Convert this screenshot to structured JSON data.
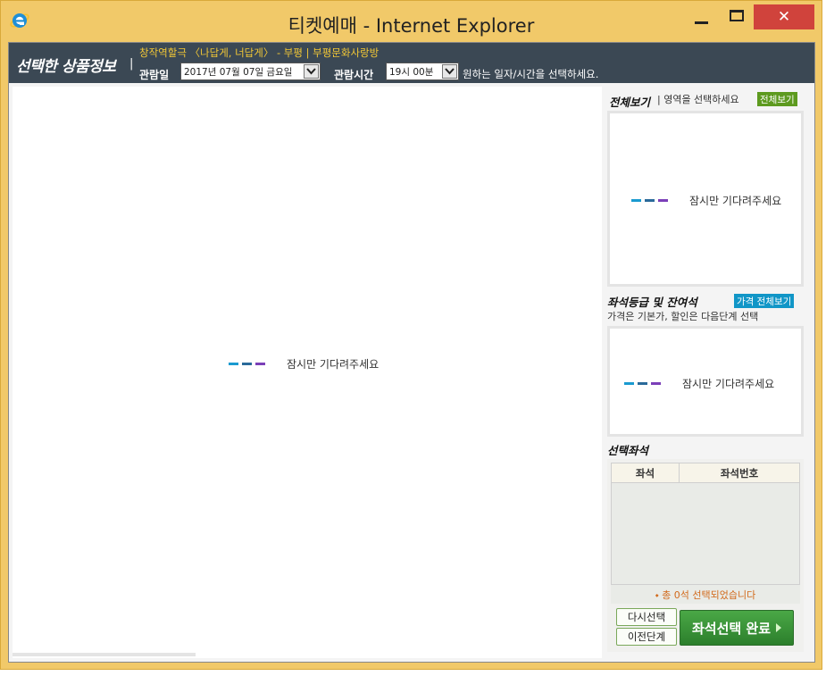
{
  "window": {
    "title": "티켓예매 - Internet Explorer",
    "close_glyph": "✕"
  },
  "header": {
    "title": "선택한 상품정보",
    "separator": "|",
    "show_title": "창작역할극 〈나답게, 너답게〉 - 부평 | 부평문화사랑방",
    "date_label": "관람일",
    "date_value": "2017년 07월 07일 금요일",
    "time_label": "관람시간",
    "time_value": "19시 00분",
    "guide": "원하는 일자/시간을 선택하세요."
  },
  "seatmap": {
    "loading_text": "잠시만 기다려주세요"
  },
  "overview": {
    "title": "전체보기",
    "subtitle": "| 영역을 선택하세요",
    "button": "전체보기",
    "loading_text": "잠시만 기다려주세요"
  },
  "grades": {
    "title": "좌석등급 및 잔여석",
    "button": "가격 전체보기",
    "note": "가격은 기본가, 할인은 다음단계 선택",
    "loading_text": "잠시만 기다려주세요"
  },
  "selected": {
    "title": "선택좌석",
    "col_seat": "좌석",
    "col_number": "좌석번호",
    "summary": "⬩ 총 0석 선택되었습니다",
    "reselect": "다시선택",
    "previous": "이전단계",
    "complete": "좌석선택 완료"
  },
  "colors": {
    "title_bar": "#f1c969",
    "header_bg": "#3b4854",
    "accent_yellow": "#f2c736",
    "green_button": "#2c7f2c",
    "blue_button": "#1196c7",
    "dash_1": "#1a9ad0",
    "dash_2": "#2a6a9a",
    "dash_3": "#7b3fb8"
  }
}
